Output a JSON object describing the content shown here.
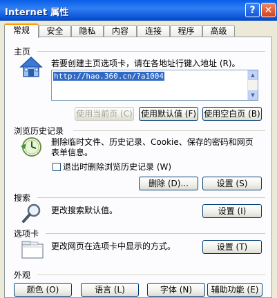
{
  "window": {
    "title": "Internet 属性",
    "help_label": "?",
    "close_label": "✕"
  },
  "tabs": [
    {
      "label": "常规",
      "active": true
    },
    {
      "label": "安全"
    },
    {
      "label": "隐私"
    },
    {
      "label": "内容"
    },
    {
      "label": "连接"
    },
    {
      "label": "程序"
    },
    {
      "label": "高级"
    }
  ],
  "homepage": {
    "heading": "主页",
    "description": "若要创建主页选项卡，请在各地址行键入地址 (R)。",
    "url": "http://hao.360.cn/?a1004",
    "buttons": {
      "use_current": "使用当前页 (C)",
      "use_default": "使用默认值 (F)",
      "use_blank": "使用空白页 (B)"
    }
  },
  "history": {
    "heading": "浏览历史记录",
    "description_line1": "删除临时文件、历史记录、Cookie、保存的密码和网页",
    "description_line2": "表单信息。",
    "checkbox_label": "退出时删除浏览历史记录 (W)",
    "delete_button": "删除 (D)...",
    "settings_button": "设置 (S)"
  },
  "search": {
    "heading": "搜索",
    "description": "更改搜索默认值。",
    "settings_button": "设置 (I)"
  },
  "tabs_section": {
    "heading": "选项卡",
    "description": "更改网页在选项卡中显示的方式。",
    "settings_button": "设置 (T)"
  },
  "appearance": {
    "heading": "外观",
    "buttons": {
      "colors": "颜色 (O)",
      "languages": "语言 (L)",
      "fonts": "字体 (N)",
      "accessibility": "辅助功能 (E)"
    }
  }
}
